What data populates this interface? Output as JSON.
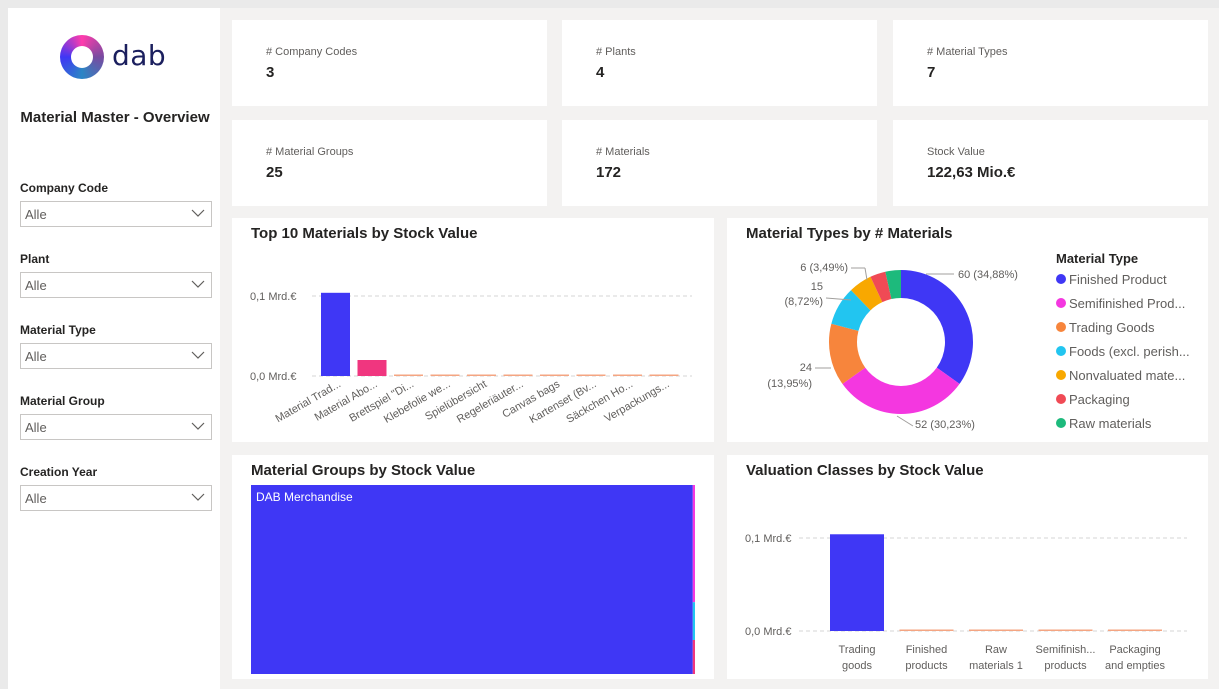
{
  "logo": {
    "text": "dab"
  },
  "report_title": "Material Master - Overview",
  "slicers": [
    {
      "label": "Company Code",
      "value": "Alle"
    },
    {
      "label": "Plant",
      "value": "Alle"
    },
    {
      "label": "Material Type",
      "value": "Alle"
    },
    {
      "label": "Material Group",
      "value": "Alle"
    },
    {
      "label": "Creation Year",
      "value": "Alle"
    }
  ],
  "kpis": [
    {
      "label": "# Company Codes",
      "value": "3"
    },
    {
      "label": "# Plants",
      "value": "4"
    },
    {
      "label": "# Material Types",
      "value": "7"
    },
    {
      "label": "# Material Groups",
      "value": "25"
    },
    {
      "label": "# Materials",
      "value": "172"
    },
    {
      "label": "Stock Value",
      "value": "122,63 Mio.€"
    }
  ],
  "colors": {
    "primary_blue": "#3f37f5",
    "pink": "#f0367f",
    "magenta": "#f437e0",
    "orange": "#f7853c",
    "cyan": "#22c5f0",
    "amber": "#f8a800",
    "red": "#f04a55",
    "green": "#1dba7c"
  },
  "chart_data": [
    {
      "type": "bar",
      "title": "Top 10 Materials by Stock Value",
      "categories": [
        "Material Trad...",
        "Material Abo...",
        "Brettspiel \"Di...",
        "Klebefolie we...",
        "Spielübersicht",
        "Regeleriäuter...",
        "Canvas bags",
        "Kartenset (Bv...",
        "Säckchen Ho...",
        "Verpackungs..."
      ],
      "values": [
        0.104,
        0.02,
        0.001,
        0.001,
        0.001,
        0.001,
        0.001,
        0.001,
        0.001,
        0.001
      ],
      "unit": "Mrd.€",
      "y_ticks": [
        "0,1 Mrd.€",
        "0,0 Mrd.€"
      ],
      "ylim": [
        0,
        0.1
      ],
      "grid": true
    },
    {
      "type": "pie",
      "title": "Material Types by # Materials",
      "legend_title": "Material Type",
      "legend_position": "right",
      "slices": [
        {
          "label": "Finished Product",
          "value": 60,
          "pct": "34,88%",
          "color": "#3f37f5"
        },
        {
          "label": "Semifinished Prod...",
          "value": 52,
          "pct": "30,23%",
          "color": "#f437e0"
        },
        {
          "label": "Trading Goods",
          "value": 24,
          "pct": "13,95%",
          "color": "#f7853c"
        },
        {
          "label": "Foods (excl. perish...",
          "value": 15,
          "pct": "8,72%",
          "color": "#22c5f0"
        },
        {
          "label": "Nonvaluated mate...",
          "value": 9,
          "pct": "",
          "color": "#f8a800"
        },
        {
          "label": "Packaging",
          "value": 6,
          "pct": "3,49%",
          "color": "#f04a55"
        },
        {
          "label": "Raw materials",
          "value": 6,
          "pct": "",
          "color": "#1dba7c"
        }
      ],
      "data_labels": [
        "60 (34,88%)",
        "52 (30,23%)",
        "24",
        "(13,95%)",
        "15",
        "(8,72%)",
        "6 (3,49%)"
      ]
    },
    {
      "type": "treemap",
      "title": "Material Groups by Stock Value",
      "items": [
        {
          "label": "DAB Merchandise",
          "share": 0.995
        }
      ]
    },
    {
      "type": "bar",
      "title": "Valuation Classes by Stock Value",
      "categories": [
        [
          "Trading",
          "goods"
        ],
        [
          "Finished",
          "products"
        ],
        [
          "Raw",
          "materials 1"
        ],
        [
          "Semifinish...",
          "products"
        ],
        [
          "Packaging",
          "and empties"
        ]
      ],
      "values": [
        0.104,
        0.001,
        0.001,
        0.001,
        0.001
      ],
      "unit": "Mrd.€",
      "y_ticks": [
        "0,1 Mrd.€",
        "0,0 Mrd.€"
      ],
      "ylim": [
        0,
        0.1
      ],
      "grid": true
    }
  ]
}
